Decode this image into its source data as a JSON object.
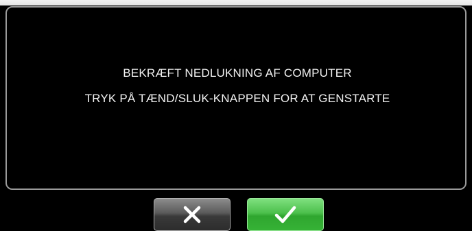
{
  "dialog": {
    "message_line_1": "BEKRÆFT NEDLUKNING AF COMPUTER",
    "message_line_2": "TRYK PÅ TÆND/SLUK-KNAPPEN FOR AT GENSTARTE"
  },
  "buttons": {
    "cancel": {
      "icon": "close-icon",
      "color": "#4a4a4a"
    },
    "confirm": {
      "icon": "checkmark-icon",
      "color": "#3fb83f"
    }
  },
  "colors": {
    "background": "#000000",
    "panel_border": "#9a9a9a",
    "text": "#f2f2f2"
  }
}
